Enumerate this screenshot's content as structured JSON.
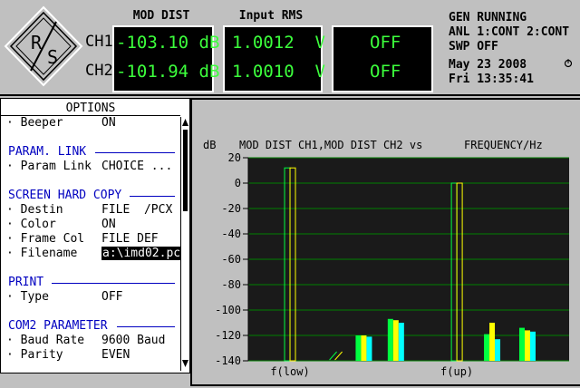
{
  "header": {
    "logo_text": "R/S",
    "col1_title": "MOD DIST",
    "col2_title": "Input RMS",
    "ch1_label": "CH1",
    "ch2_label": "CH2",
    "ch1_moddist": "-103.10 dB",
    "ch2_moddist": "-101.94 dB",
    "ch1_rms": "1.0012  V",
    "ch2_rms": "1.0010  V",
    "ch1_extra": "OFF",
    "ch2_extra": "OFF",
    "status1": "GEN RUNNING",
    "status2": "ANL 1:CONT 2:CONT",
    "status3": "SWP OFF",
    "date": "May 23 2008",
    "time": "Fri 13:35:41",
    "status_icon": "hourglass-icon",
    "lcd_color": "#3cff3c"
  },
  "options": {
    "title": "OPTIONS",
    "beeper_label": "· Beeper",
    "beeper_value": "ON",
    "param_link_section": "PARAM. LINK",
    "param_link_label": "· Param Link",
    "param_link_value": "CHOICE ...",
    "hardcopy_section": "SCREEN HARD COPY",
    "destin_label": "· Destin",
    "destin_value": "FILE  /PCX",
    "color_label": "· Color",
    "color_value": "ON",
    "framecol_label": "· Frame Col",
    "framecol_value": "FILE DEF",
    "filename_label": "· Filename",
    "filename_value": "a:\\imd02.pc",
    "print_section": "PRINT",
    "type_label": "· Type",
    "type_value": "OFF",
    "com2_section": "COM2 PARAMETER",
    "baud_label": "· Baud Rate",
    "baud_value": "9600 Baud",
    "parity_label": "· Parity",
    "parity_value": "EVEN"
  },
  "chart_data": {
    "type": "bar",
    "title": "MOD DIST CH1,MOD DIST CH2 vs",
    "xlabel_right": "FREQUENCY/Hz",
    "ylabel": "dB",
    "ylim": [
      -140,
      20
    ],
    "yticks": [
      20,
      0,
      -20,
      -40,
      -60,
      -80,
      -100,
      -120,
      -140
    ],
    "xlabels": [
      "f(low)",
      "f(up)"
    ],
    "series_colors": [
      "#00ff40",
      "#ffff00",
      "#00ffff"
    ],
    "groups": [
      {
        "x": 0.13,
        "values": [
          12,
          12
        ]
      },
      {
        "x": 0.27,
        "values": [
          -140,
          -140
        ]
      },
      {
        "x": 0.36,
        "values": [
          -120,
          -120,
          -121
        ]
      },
      {
        "x": 0.46,
        "values": [
          -107,
          -108,
          -110
        ]
      },
      {
        "x": 0.65,
        "values": [
          0,
          0
        ]
      },
      {
        "x": 0.76,
        "values": [
          -119,
          -110,
          -123
        ]
      },
      {
        "x": 0.87,
        "values": [
          -114,
          -116,
          -117
        ]
      }
    ]
  }
}
